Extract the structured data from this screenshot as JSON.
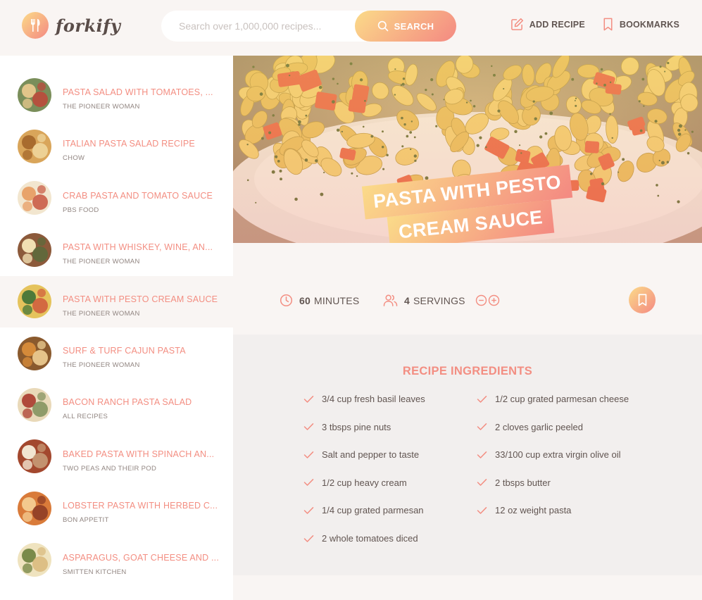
{
  "app": {
    "name": "forkify"
  },
  "colors": {
    "accent_start": "#fbdb89",
    "accent_end": "#f48982",
    "title": "#f38e82",
    "text": "#615551"
  },
  "search": {
    "placeholder": "Search over 1,000,000 recipes...",
    "value": "",
    "button_label": "SEARCH"
  },
  "nav": {
    "add_recipe": "ADD RECIPE",
    "bookmarks": "BOOKMARKS"
  },
  "results": [
    {
      "title": "PASTA SALAD WITH TOMATOES, ...",
      "publisher": "THE PIONEER WOMAN",
      "active": false
    },
    {
      "title": "ITALIAN PASTA SALAD RECIPE",
      "publisher": "CHOW",
      "active": false
    },
    {
      "title": "CRAB PASTA AND TOMATO SAUCE",
      "publisher": "PBS FOOD",
      "active": false
    },
    {
      "title": "PASTA WITH WHISKEY, WINE, AN...",
      "publisher": "THE PIONEER WOMAN",
      "active": false
    },
    {
      "title": "PASTA WITH PESTO CREAM SAUCE",
      "publisher": "THE PIONEER WOMAN",
      "active": true
    },
    {
      "title": "SURF & TURF CAJUN PASTA",
      "publisher": "THE PIONEER WOMAN",
      "active": false
    },
    {
      "title": "BACON RANCH PASTA SALAD",
      "publisher": "ALL RECIPES",
      "active": false
    },
    {
      "title": "BAKED PASTA WITH SPINACH AN...",
      "publisher": "TWO PEAS AND THEIR POD",
      "active": false
    },
    {
      "title": "LOBSTER PASTA WITH HERBED C...",
      "publisher": "BON APPETIT",
      "active": false
    },
    {
      "title": "ASPARAGUS, GOAT CHEESE AND ...",
      "publisher": "SMITTEN KITCHEN",
      "active": false
    }
  ],
  "recipe": {
    "title_line1": "PASTA WITH PESTO",
    "title_line2": "CREAM SAUCE",
    "minutes": "60",
    "minutes_label": "MINUTES",
    "servings": "4",
    "servings_label": "SERVINGS",
    "ingredients_heading": "RECIPE INGREDIENTS",
    "ingredients": [
      "3/4 cup fresh basil leaves",
      "1/2 cup grated parmesan cheese",
      "3 tbsps pine nuts",
      "2 cloves garlic peeled",
      " Salt and pepper to taste",
      "33/100 cup extra virgin olive oil",
      "1/2 cup heavy cream",
      "2 tbsps butter",
      "1/4 cup grated parmesan",
      "12 oz weight pasta",
      "2 whole tomatoes diced"
    ]
  },
  "icons": {
    "logo": "fork-knife-icon",
    "search": "search-icon",
    "add_recipe": "edit-icon",
    "bookmarks": "bookmark-icon",
    "time": "clock-icon",
    "servings": "users-icon",
    "decrease": "minus-circle-icon",
    "increase": "plus-circle-icon",
    "check": "check-icon"
  }
}
